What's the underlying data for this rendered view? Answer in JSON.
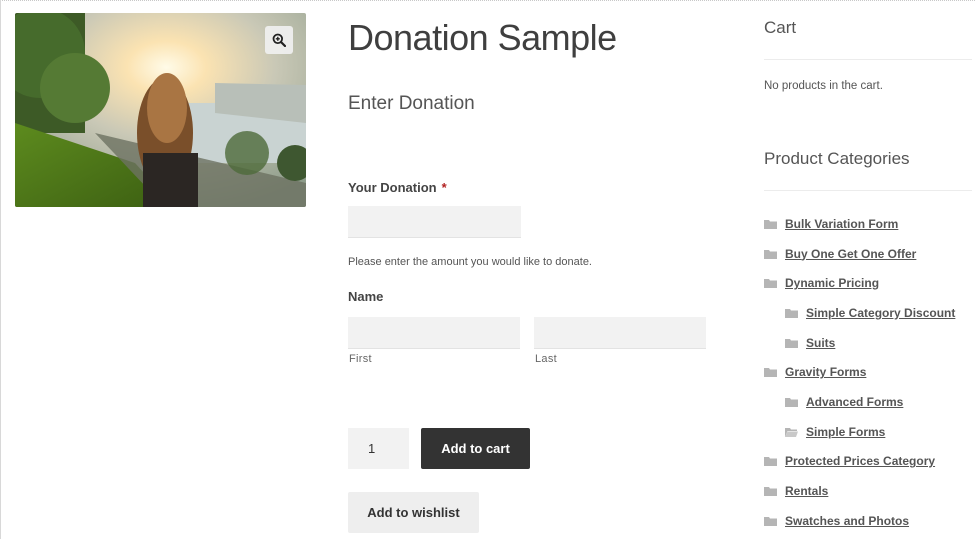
{
  "product": {
    "title": "Donation Sample",
    "image_alt": "Woman with long hair walking along a river path at sunset",
    "zoom_icon": "zoom-in-icon"
  },
  "form": {
    "section_title": "Enter Donation",
    "donation_label": "Your Donation",
    "required_mark": "*",
    "donation_value": "",
    "donation_help": "Please enter the amount you would like to donate.",
    "name_label": "Name",
    "first_value": "",
    "first_sublabel": "First",
    "last_value": "",
    "last_sublabel": "Last",
    "quantity": "1",
    "add_to_cart_label": "Add to cart",
    "wishlist_label": "Add to wishlist"
  },
  "sidebar": {
    "cart_title": "Cart",
    "cart_empty": "No products in the cart.",
    "categories_title": "Product Categories",
    "categories": [
      {
        "label": "Bulk Variation Form",
        "child": false
      },
      {
        "label": "Buy One Get One Offer",
        "child": false
      },
      {
        "label": "Dynamic Pricing",
        "child": false
      },
      {
        "label": "Simple Category Discount",
        "child": true
      },
      {
        "label": "Suits",
        "child": true
      },
      {
        "label": "Gravity Forms",
        "child": false
      },
      {
        "label": "Advanced Forms",
        "child": true
      },
      {
        "label": "Simple Forms",
        "child": true,
        "open": true
      },
      {
        "label": "Protected Prices Category",
        "child": false
      },
      {
        "label": "Rentals",
        "child": false
      },
      {
        "label": "Swatches and Photos",
        "child": false
      }
    ]
  },
  "colors": {
    "button_dark": "#333333",
    "input_bg": "#f2f2f2",
    "required": "#b22222",
    "folder": "#b5b5b5"
  }
}
